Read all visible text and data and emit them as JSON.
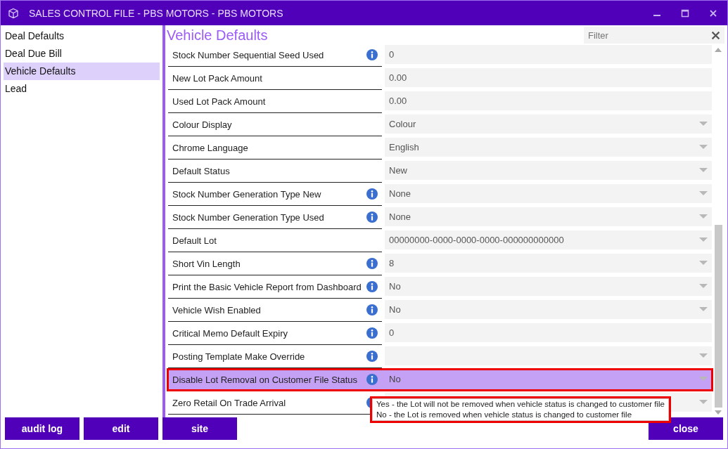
{
  "window": {
    "title": "SALES CONTROL FILE - PBS MOTORS - PBS MOTORS"
  },
  "sidebar": {
    "items": [
      {
        "label": "Deal Defaults",
        "selected": false
      },
      {
        "label": "Deal Due Bill",
        "selected": false
      },
      {
        "label": "Vehicle Defaults",
        "selected": true
      },
      {
        "label": "Lead",
        "selected": false
      }
    ]
  },
  "heading": "Vehicle Defaults",
  "filter": {
    "placeholder": "Filter"
  },
  "settings": [
    {
      "label": "Stock Number Sequential Seed Used",
      "info": true,
      "kind": "text",
      "value": "0",
      "selected": false
    },
    {
      "label": "New Lot Pack Amount",
      "info": false,
      "kind": "text",
      "value": "0.00",
      "selected": false
    },
    {
      "label": "Used Lot Pack Amount",
      "info": false,
      "kind": "text",
      "value": "0.00",
      "selected": false
    },
    {
      "label": "Colour Display",
      "info": false,
      "kind": "dropdown",
      "value": "Colour",
      "selected": false
    },
    {
      "label": "Chrome Language",
      "info": false,
      "kind": "dropdown",
      "value": "English",
      "selected": false
    },
    {
      "label": "Default Status",
      "info": false,
      "kind": "dropdown",
      "value": "New",
      "selected": false
    },
    {
      "label": "Stock Number Generation Type New",
      "info": true,
      "kind": "dropdown",
      "value": "None",
      "selected": false
    },
    {
      "label": "Stock Number Generation Type Used",
      "info": true,
      "kind": "dropdown",
      "value": "None",
      "selected": false
    },
    {
      "label": "Default Lot",
      "info": false,
      "kind": "dropdown",
      "value": "00000000-0000-0000-0000-000000000000",
      "selected": false
    },
    {
      "label": "Short Vin Length",
      "info": true,
      "kind": "dropdown",
      "value": "8",
      "selected": false
    },
    {
      "label": "Print the Basic Vehicle Report from Dashboard",
      "info": true,
      "kind": "dropdown",
      "value": "No",
      "selected": false
    },
    {
      "label": "Vehicle Wish Enabled",
      "info": true,
      "kind": "dropdown",
      "value": "No",
      "selected": false
    },
    {
      "label": "Critical Memo Default Expiry",
      "info": true,
      "kind": "text",
      "value": "0",
      "selected": false
    },
    {
      "label": "Posting Template Make Override",
      "info": true,
      "kind": "dropdown",
      "selected": false
    },
    {
      "label": "Disable Lot Removal on Customer File Status",
      "info": true,
      "kind": "dropdown",
      "value": "No",
      "selected": true
    },
    {
      "label": "Zero Retail On Trade Arrival",
      "info": true,
      "kind": "dropdown",
      "selected": false
    }
  ],
  "tooltip": [
    "Yes - the Lot will not be removed when vehicle status is changed to customer file",
    "No - the Lot is removed when vehicle status is changed to customer file"
  ],
  "buttons": [
    "audit log",
    "edit",
    "site"
  ],
  "close_button": "close"
}
